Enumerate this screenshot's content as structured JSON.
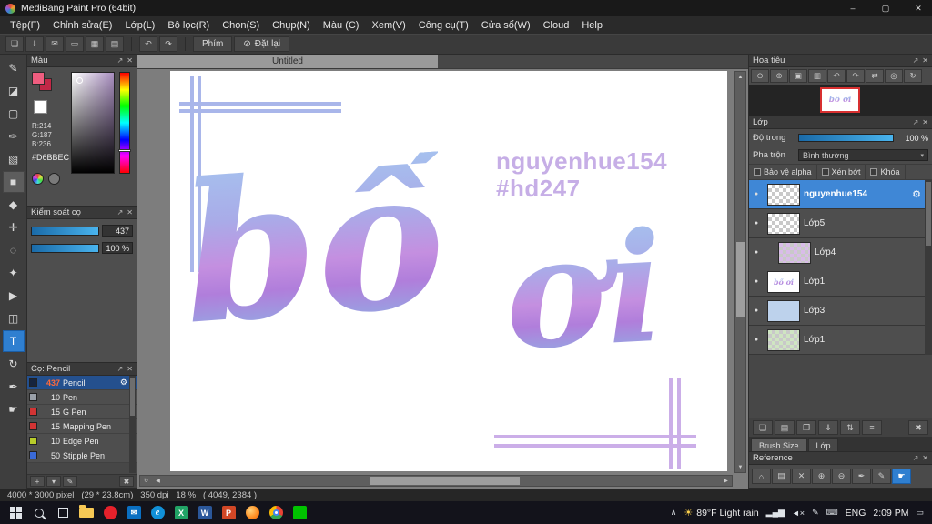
{
  "window": {
    "title": "MediBang Paint Pro (64bit)",
    "minimize": "–",
    "maximize": "▢",
    "close": "✕"
  },
  "menu": {
    "items": [
      "Tệp(F)",
      "Chỉnh sửa(E)",
      "Lớp(L)",
      "Bộ lọc(R)",
      "Chọn(S)",
      "Chụp(N)",
      "Màu (C)",
      "Xem(V)",
      "Công cụ(T)",
      "Cửa sổ(W)",
      "Cloud",
      "Help"
    ]
  },
  "toolbar": {
    "icons": [
      {
        "name": "new-document",
        "glyph": "❏"
      },
      {
        "name": "save",
        "glyph": "⇓"
      },
      {
        "name": "publish",
        "glyph": "✉"
      },
      {
        "name": "display",
        "glyph": "▭"
      },
      {
        "name": "grid",
        "glyph": "▦"
      },
      {
        "name": "material",
        "glyph": "▤"
      }
    ],
    "undo": "↶",
    "redo": "↷",
    "phim_label": "Phím",
    "reset_icon": "⊘",
    "reset_label": "Đặt lại"
  },
  "tools": [
    {
      "name": "pen-tool",
      "glyph": "✎"
    },
    {
      "name": "eraser-tool",
      "glyph": "◪"
    },
    {
      "name": "select-tool",
      "glyph": "▢"
    },
    {
      "name": "brush-tool",
      "glyph": "✑"
    },
    {
      "name": "gradient-tool",
      "glyph": "▧"
    },
    {
      "name": "shape-tool",
      "glyph": "■",
      "highlighted": true
    },
    {
      "name": "bucket-tool",
      "glyph": "◆"
    },
    {
      "name": "move-tool",
      "glyph": "✛"
    },
    {
      "name": "lasso-tool",
      "glyph": "◌"
    },
    {
      "name": "wand-tool",
      "glyph": "✦"
    },
    {
      "name": "operation-tool",
      "glyph": "▶"
    },
    {
      "name": "divide-tool",
      "glyph": "◫"
    },
    {
      "name": "text-tool",
      "glyph": "T",
      "active": true
    },
    {
      "name": "rotate-tool",
      "glyph": "↻"
    },
    {
      "name": "eyedropper-tool",
      "glyph": "✒"
    },
    {
      "name": "hand-tool",
      "glyph": "☛"
    }
  ],
  "canvas": {
    "tab": "Untitled",
    "watermark1": "nguyenhue154",
    "watermark2": "#hd247",
    "word1": "bố",
    "word2": "ơi",
    "thumb_text": "bố ơi"
  },
  "color_panel": {
    "title": "Màu",
    "r": "R:214",
    "g": "G:187",
    "b": "B:236",
    "hex": "#D6BBEC"
  },
  "brush_control": {
    "title": "Kiểm soát cọ",
    "size": "437",
    "opacity": "100 %"
  },
  "brushes": {
    "title": "Cọ: Pencil",
    "items": [
      {
        "size": "437",
        "name": "Pencil",
        "chip": "#16243e",
        "selected": true
      },
      {
        "size": "10",
        "name": "Pen",
        "chip": "#9aa0a8"
      },
      {
        "size": "15",
        "name": "G Pen",
        "chip": "#d23434"
      },
      {
        "size": "15",
        "name": "Mapping Pen",
        "chip": "#d23434"
      },
      {
        "size": "10",
        "name": "Edge Pen",
        "chip": "#b8cc2a"
      },
      {
        "size": "50",
        "name": "Stipple Pen",
        "chip": "#3a6ad8"
      }
    ],
    "footer": [
      {
        "name": "add-brush",
        "glyph": "+"
      },
      {
        "name": "brush-menu",
        "glyph": "▾"
      },
      {
        "name": "edit-brush",
        "glyph": "✎"
      },
      {
        "name": "delete-brush",
        "glyph": "✖"
      }
    ]
  },
  "navigator": {
    "title": "Hoa tiêu",
    "icons": [
      {
        "name": "zoom-out",
        "glyph": "⊖"
      },
      {
        "name": "zoom-in",
        "glyph": "⊕"
      },
      {
        "name": "fit-window",
        "glyph": "▣"
      },
      {
        "name": "actual-size",
        "glyph": "▥"
      },
      {
        "name": "rotate-left",
        "glyph": "↶"
      },
      {
        "name": "rotate-right",
        "glyph": "↷"
      },
      {
        "name": "flip-horizontal",
        "glyph": "⇄"
      },
      {
        "name": "reset-view",
        "glyph": "◎"
      },
      {
        "name": "spin-view",
        "glyph": "↻"
      }
    ]
  },
  "layers": {
    "title": "Lớp",
    "opacity_label": "Độ trong",
    "opacity_value": "100 %",
    "blend_label": "Pha trộn",
    "blend_value": "Bình thường",
    "check_alpha": "Bảo vệ alpha",
    "check_clip": "Xén bớt",
    "check_lock": "Khóa",
    "items": [
      {
        "name": "nguyenhue154",
        "selected": true
      },
      {
        "name": "Lớp5"
      },
      {
        "name": "Lớp4",
        "clipped": true
      },
      {
        "name": "Lớp1"
      },
      {
        "name": "Lớp3"
      },
      {
        "name": "Lớp1"
      }
    ],
    "buttons": [
      {
        "name": "add-layer",
        "glyph": "❏"
      },
      {
        "name": "add-folder",
        "glyph": "▤"
      },
      {
        "name": "duplicate-layer",
        "glyph": "❐"
      },
      {
        "name": "merge-layer",
        "glyph": "⇓"
      },
      {
        "name": "transfer-layer",
        "glyph": "⇅"
      },
      {
        "name": "combine-layers",
        "glyph": "≡"
      },
      {
        "name": "delete-layer",
        "glyph": "✖"
      }
    ],
    "tabs": [
      "Brush Size",
      "Lớp"
    ]
  },
  "reference": {
    "title": "Reference",
    "icons": [
      {
        "name": "home",
        "glyph": "⌂"
      },
      {
        "name": "open-folder",
        "glyph": "▤"
      },
      {
        "name": "clear",
        "glyph": "✕"
      },
      {
        "name": "zoom-in",
        "glyph": "⊕"
      },
      {
        "name": "zoom-out",
        "glyph": "⊖"
      },
      {
        "name": "eyedropper",
        "glyph": "✒"
      },
      {
        "name": "pencil",
        "glyph": "✎"
      },
      {
        "name": "hand",
        "glyph": "☛",
        "active": true
      }
    ]
  },
  "statusbar": {
    "text": "4000 * 3000 pixel   (29 * 23.8cm)   350 dpi   18 %   ( 4049, 2384 )"
  },
  "taskbar": {
    "weather": "89°F Light rain",
    "lang": "ENG",
    "time": "2:09 PM",
    "app_letters": {
      "mail": "✉",
      "edge": "e",
      "excel": "X",
      "word": "W",
      "powerpoint": "P"
    }
  },
  "icons": {
    "popout": "↗",
    "panel_close": "✕",
    "eye": "●",
    "gear": "⚙",
    "caret_down": "▾",
    "scroll_up": "▲",
    "scroll_down": "▼",
    "scroll_left": "◀",
    "scroll_right": "▶",
    "rotate": "↻",
    "caret_up": "∧",
    "signal": "▂▄▆",
    "mute": "◄×",
    "pen": "✎",
    "keyboard": "⌨",
    "sun": "☀",
    "notifications": "▭"
  },
  "colors": {
    "accent": "#3f87d6",
    "slider": "#2f9ce0",
    "art_top": "#a6c0ee",
    "art_mid": "#c48fe0",
    "art_bottom": "#8fb0e4",
    "watermark": "#c0a6e4",
    "deco_blue": "#a9b6ea",
    "deco_purple": "#cbaee8",
    "nav_view_rect": "#d83030"
  }
}
